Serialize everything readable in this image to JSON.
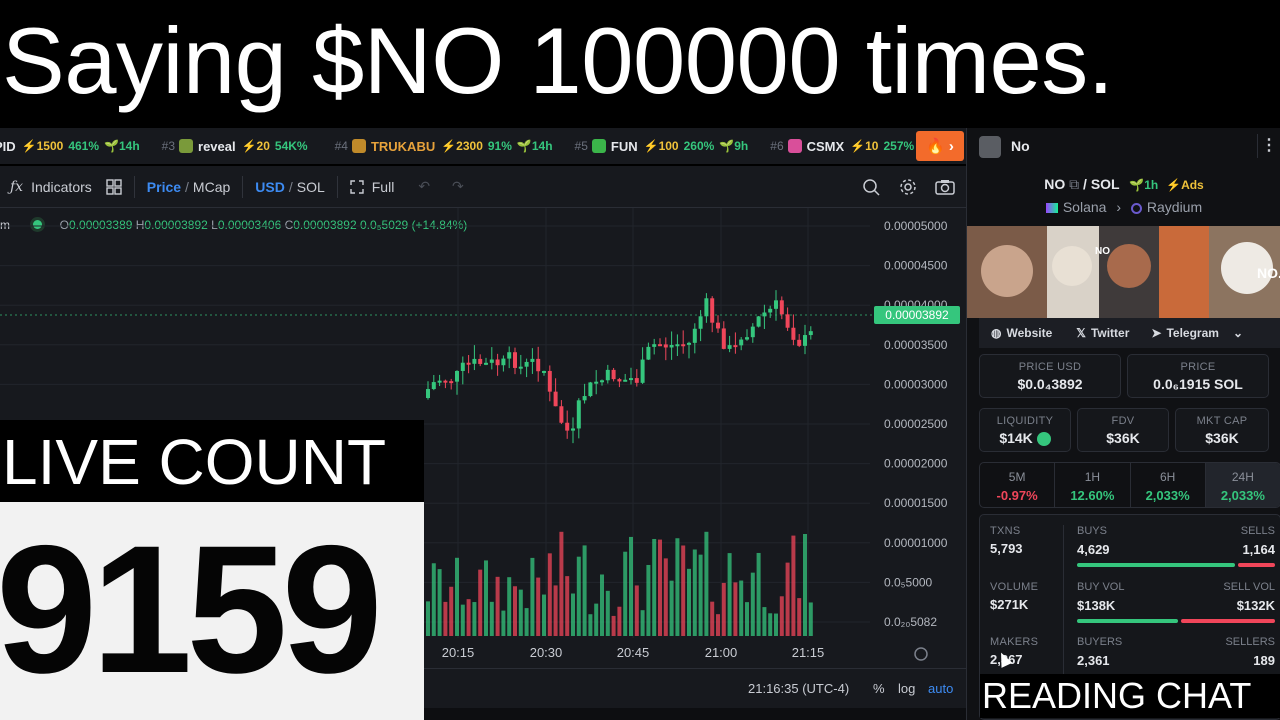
{
  "title": "Saying $NO 100000 times.",
  "ticker": [
    {
      "rank": "",
      "name": "PID",
      "boost": "⚡1500",
      "pct": "461%",
      "age": "14h",
      "logo": "",
      "orange": false
    },
    {
      "rank": "#3",
      "name": "reveal",
      "boost": "⚡20",
      "pct": "54K%",
      "age": "",
      "logo": "#7a9a3a",
      "orange": false
    },
    {
      "rank": "#4",
      "name": "TRUKABU",
      "boost": "⚡2300",
      "pct": "91%",
      "age": "14h",
      "logo": "#c08a2a",
      "orange": true
    },
    {
      "rank": "#5",
      "name": "FUN",
      "boost": "⚡100",
      "pct": "260%",
      "age": "9h",
      "logo": "#3bb54a",
      "orange": false
    },
    {
      "rank": "#6",
      "name": "CSMX",
      "boost": "⚡10",
      "pct": "257%",
      "age": "",
      "logo": "#d94f9a",
      "orange": false
    }
  ],
  "toolbar": {
    "indicators": "Indicators",
    "price": "Price",
    "mcap": "MCap",
    "usd": "USD",
    "sol": "SOL",
    "full": "Full"
  },
  "ohlc": {
    "o": "0.00003389",
    "h": "0.00003892",
    "l": "0.00003406",
    "c": "0.00003892",
    "change": "0.0₅5029 (+14.84%)"
  },
  "price_axis": [
    "0.00005000",
    "0.00004500",
    "0.00004000",
    "0.00003500",
    "0.00003000",
    "0.00002500",
    "0.00002000",
    "0.00001500",
    "0.00001000",
    "0.0₅5000",
    "0.0₂₀5082"
  ],
  "current_price": "0.00003892",
  "time_axis": [
    "20:15",
    "20:30",
    "20:45",
    "21:00",
    "21:15"
  ],
  "clock": "21:16:35 (UTC-4)",
  "scale_opts": {
    "pct": "%",
    "log": "log",
    "auto": "auto"
  },
  "live": {
    "label": "LIVE COUNT",
    "count": "9159"
  },
  "chat_label": "READING CHAT",
  "panel": {
    "token_name": "No",
    "pair_base": "NO",
    "pair_quote": "SOL",
    "age": "1h",
    "ads": "Ads",
    "chain": "Solana",
    "dex": "Raydium",
    "website": "Website",
    "twitter": "Twitter",
    "telegram": "Telegram",
    "price_usd_label": "PRICE USD",
    "price_usd": "$0.0₄3892",
    "price_label": "PRICE",
    "price_sol": "0.0₆1915 SOL",
    "liquidity_label": "LIQUIDITY",
    "liquidity": "$14K",
    "fdv_label": "FDV",
    "fdv": "$36K",
    "mktcap_label": "MKT CAP",
    "mktcap": "$36K",
    "tabs": [
      {
        "label": "5M",
        "value": "-0.97%",
        "color": "#f0465a"
      },
      {
        "label": "1H",
        "value": "12.60%",
        "color": "#35c67d"
      },
      {
        "label": "6H",
        "value": "2,033%",
        "color": "#35c67d"
      },
      {
        "label": "24H",
        "value": "2,033%",
        "color": "#35c67d"
      }
    ],
    "stats": [
      {
        "l_label": "TXNS",
        "l_val": "5,793",
        "a_label": "BUYS",
        "a_val": "4,629",
        "b_label": "SELLS",
        "b_val": "1,164",
        "ratio": 0.8
      },
      {
        "l_label": "VOLUME",
        "l_val": "$271K",
        "a_label": "BUY VOL",
        "a_val": "$138K",
        "b_label": "SELL VOL",
        "b_val": "$132K",
        "ratio": 0.51
      },
      {
        "l_label": "MAKERS",
        "l_val": "2,367",
        "a_label": "BUYERS",
        "a_val": "2,361",
        "b_label": "SELLERS",
        "b_val": "189",
        "ratio": 0.93
      }
    ]
  },
  "colors": {
    "up": "#35c67d",
    "down": "#f0465a",
    "accent": "#3d8bf2"
  }
}
